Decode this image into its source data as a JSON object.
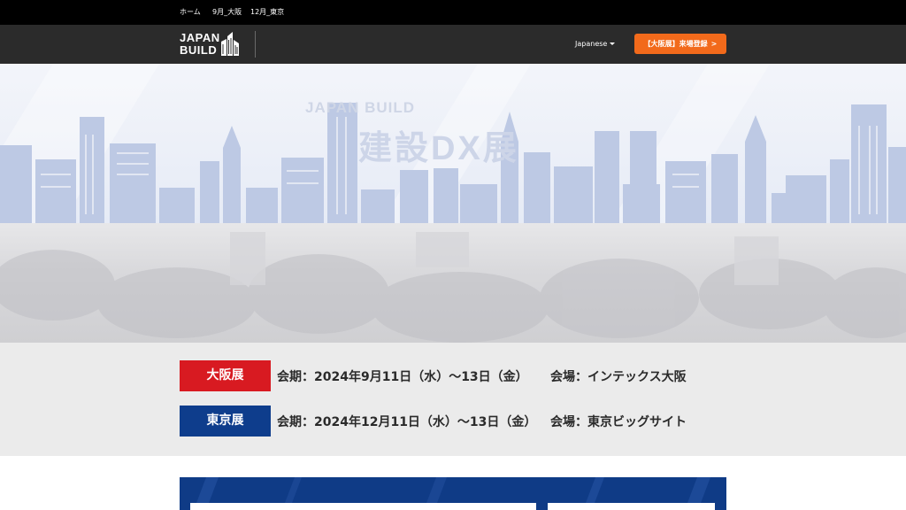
{
  "topnav": {
    "items": [
      {
        "label": "ホーム"
      },
      {
        "label": "9月_大阪"
      },
      {
        "label": "12月_東京"
      }
    ]
  },
  "header": {
    "logo_line1": "JAPAN",
    "logo_line2": "BUILD",
    "language": "Japanese",
    "register_label": "【大阪展】来場登録",
    "register_arrow": ">"
  },
  "hero": {
    "watermark_brand": "JAPAN BUILD",
    "watermark_title": "建設DX展"
  },
  "schedule": [
    {
      "badge": "大阪展",
      "dates": "会期：2024年9月11日（水）～13日（金）",
      "venue": "会場：インテックス大阪",
      "color": "#d81a21"
    },
    {
      "badge": "東京展",
      "dates": "会期：2024年12月11日（水）～13日（金）",
      "venue": "会場：東京ビッグサイト",
      "color": "#0e3d8c"
    }
  ],
  "colors": {
    "accent_orange": "#f26a1b",
    "osaka_red": "#d81a21",
    "tokyo_blue": "#0e3d8c",
    "header_bg": "#2b2b2b"
  }
}
